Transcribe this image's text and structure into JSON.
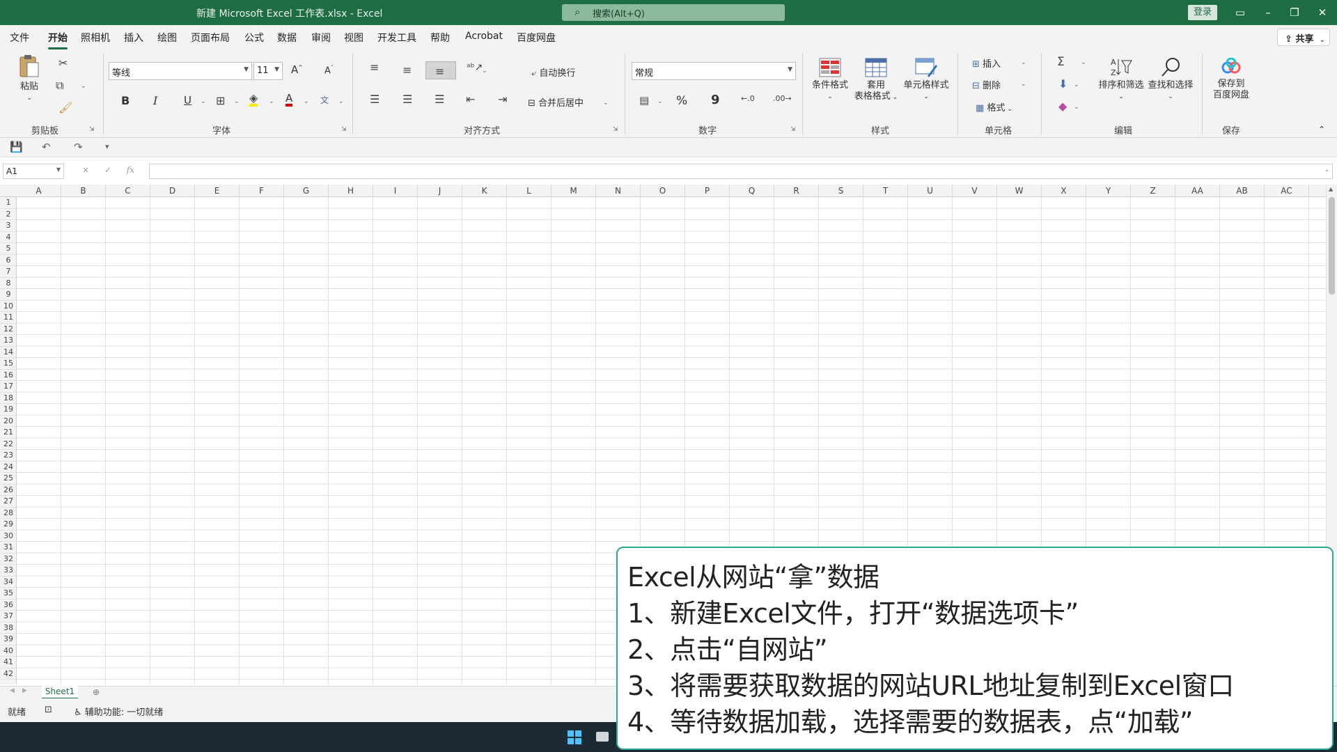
{
  "titlebar": {
    "title": "新建 Microsoft Excel 工作表.xlsx  -  Excel",
    "search_placeholder": "搜索(Alt+Q)",
    "login": "登录",
    "ribbon_display_icon": "ribbon-display-icon",
    "minimize_icon": "minimize-icon",
    "restore_icon": "restore-icon",
    "close_icon": "close-icon"
  },
  "menu": {
    "tabs": [
      "文件",
      "开始",
      "照相机",
      "插入",
      "绘图",
      "页面布局",
      "公式",
      "数据",
      "审阅",
      "视图",
      "开发工具",
      "帮助",
      "Acrobat",
      "百度网盘"
    ],
    "active": "开始",
    "share": "共享"
  },
  "ribbon": {
    "clipboard": {
      "label": "剪贴板",
      "paste": "粘贴"
    },
    "font": {
      "label": "字体",
      "font_name": "等线",
      "font_size": "11",
      "grow": "A",
      "shrink": "A",
      "bold": "B",
      "italic": "I",
      "underline": "U",
      "font_color_letter": "A",
      "phonetic_letter": "文"
    },
    "alignment": {
      "label": "对齐方式",
      "wrap_text": "自动换行",
      "merge_center": "合并后居中"
    },
    "number": {
      "label": "数字",
      "format": "常规",
      "percent": "%",
      "comma": "9"
    },
    "styles": {
      "label": "样式",
      "conditional": "条件格式",
      "table_format_1": "套用",
      "table_format_2": "表格格式",
      "cell_styles": "单元格样式"
    },
    "cells": {
      "label": "单元格",
      "insert": "插入",
      "delete": "删除",
      "format": "格式"
    },
    "editing": {
      "label": "编辑",
      "sort_filter": "排序和筛选",
      "find_select": "查找和选择"
    },
    "save": {
      "label": "保存",
      "baidu_1": "保存到",
      "baidu_2": "百度网盘"
    }
  },
  "formula_bar": {
    "name_box": "A1",
    "fx": "fx",
    "cancel": "×",
    "enter": "✓",
    "value": ""
  },
  "grid": {
    "columns": [
      "A",
      "B",
      "C",
      "D",
      "E",
      "F",
      "G",
      "H",
      "I",
      "J",
      "K",
      "L",
      "M",
      "N",
      "O",
      "P",
      "Q",
      "R",
      "S",
      "T",
      "U",
      "V",
      "W",
      "X",
      "Y",
      "Z",
      "AA",
      "AB",
      "AC"
    ],
    "rows": [
      "1",
      "2",
      "3",
      "4",
      "5",
      "6",
      "7",
      "8",
      "9",
      "10",
      "11",
      "12",
      "13",
      "14",
      "15",
      "16",
      "17",
      "18",
      "19",
      "20",
      "21",
      "22",
      "23",
      "24",
      "25",
      "26",
      "27",
      "28",
      "29",
      "30",
      "31",
      "32",
      "33",
      "34",
      "35",
      "36",
      "37",
      "38",
      "39",
      "40",
      "41",
      "42"
    ]
  },
  "sheets": {
    "active": "Sheet1"
  },
  "status": {
    "ready": "就绪",
    "accessibility": "辅助功能: 一切就绪"
  },
  "overlay": {
    "lines": [
      "Excel从网站“拿”数据",
      "1、新建Excel文件，打开“数据选项卡”",
      "2、点击“自网站”",
      "3、将需要获取数据的网站URL地址复制到Excel窗口",
      "4、等待数据加载，选择需要的数据表，点“加载”"
    ]
  },
  "colors": {
    "excel_green": "#1f6e43",
    "overlay_border": "#2aa899",
    "taskbar": "#1c2a33"
  }
}
